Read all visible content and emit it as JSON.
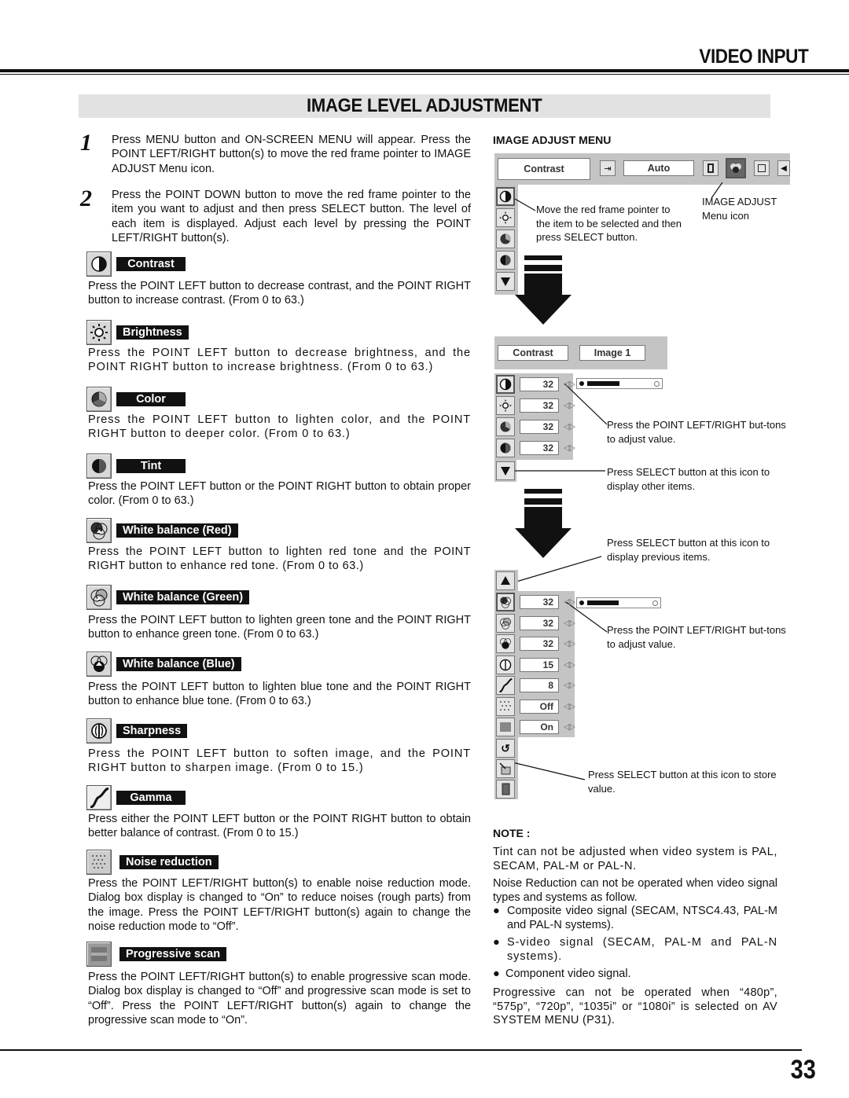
{
  "header": {
    "section": "VIDEO INPUT",
    "title": "IMAGE LEVEL ADJUSTMENT"
  },
  "steps": [
    {
      "number": "1",
      "text": "Press MENU button and ON-SCREEN MENU will appear.  Press the POINT LEFT/RIGHT button(s) to move the red frame pointer to IMAGE ADJUST Menu icon."
    },
    {
      "number": "2",
      "text": "Press the POINT DOWN button to move the red frame pointer to the item you want to adjust and then press SELECT button.  The level of each item is displayed.  Adjust each level by pressing the POINT LEFT/RIGHT button(s)."
    }
  ],
  "items": [
    {
      "icon": "contrast-icon",
      "label": "Contrast",
      "text": "Press the POINT LEFT button to decrease contrast, and the POINT RIGHT button to increase contrast.  (From 0 to 63.)"
    },
    {
      "icon": "brightness-icon",
      "label": "Brightness",
      "text": "Press the POINT LEFT button to decrease brightness, and the POINT RIGHT button to increase brightness.  (From 0 to 63.)"
    },
    {
      "icon": "color-icon",
      "label": "Color",
      "text": "Press the POINT LEFT button to lighten color, and the POINT RIGHT button to deeper color.  (From 0 to 63.)"
    },
    {
      "icon": "tint-icon",
      "label": "Tint",
      "text": "Press the POINT LEFT button or the POINT RIGHT button to obtain proper color.  (From 0 to 63.)"
    },
    {
      "icon": "white-balance-red-icon",
      "label": "White balance (Red)",
      "text": "Press the POINT LEFT button to lighten red tone and the POINT RIGHT button to enhance red tone.  (From 0 to 63.)"
    },
    {
      "icon": "white-balance-green-icon",
      "label": "White balance (Green)",
      "text": "Press the POINT LEFT button to lighten green tone and the POINT RIGHT button to enhance green tone.  (From 0 to 63.)"
    },
    {
      "icon": "white-balance-blue-icon",
      "label": "White balance (Blue)",
      "text": "Press the POINT LEFT button to lighten blue tone and the POINT RIGHT button to enhance blue tone.  (From 0 to 63.)"
    },
    {
      "icon": "sharpness-icon",
      "label": "Sharpness",
      "text": "Press the POINT LEFT button to soften image, and the POINT RIGHT button to sharpen image.  (From 0 to 15.)"
    },
    {
      "icon": "gamma-icon",
      "label": "Gamma",
      "text": "Press either the POINT LEFT button or the POINT RIGHT button to obtain better balance of contrast.  (From 0 to 15.)"
    },
    {
      "icon": "noise-reduction-icon",
      "label": "Noise reduction",
      "text": "Press the POINT LEFT/RIGHT button(s) to enable noise reduction mode.  Dialog box display is changed to “On” to reduce noises (rough parts) from the image. Press the POINT LEFT/RIGHT button(s) again to change the noise reduction mode to “Off”."
    },
    {
      "icon": "progressive-scan-icon",
      "label": "Progressive scan",
      "text": "Press the POINT LEFT/RIGHT button(s) to enable progressive scan mode.  Dialog box display is changed to “Off” and progressive scan mode is set to “Off”. Press the POINT LEFT/RIGHT button(s) again to change the progressive scan mode to “On”."
    }
  ],
  "menu": {
    "heading": "IMAGE ADJUST MENU",
    "top_bar": {
      "item_label": "Contrast",
      "mode_label": "Auto"
    },
    "callout_pointer": "Move the red frame pointer to the item to be selected and then press SELECT button.",
    "callout_menu_icon": "IMAGE ADJUST Menu icon",
    "panel2": {
      "item_label": "Contrast",
      "mode_label": "Image 1",
      "values": [
        "32",
        "32",
        "32",
        "32"
      ],
      "slider_fraction": 0.5
    },
    "callout_adjust": "Press the POINT LEFT/RIGHT but-tons to adjust value.",
    "callout_other": "Press SELECT button at this icon to display other items.",
    "callout_previous": "Press SELECT button at this icon to display previous items.",
    "panel3": {
      "values": [
        "32",
        "32",
        "32",
        "15",
        "8",
        "Off",
        "On"
      ],
      "slider_fraction": 0.5
    },
    "callout_adjust2": "Press the POINT LEFT/RIGHT but-tons to adjust value.",
    "callout_store": "Press SELECT button at this icon to store value."
  },
  "note": {
    "title": "NOTE :",
    "p1": "Tint can not be adjusted when video system is PAL, SECAM, PAL-M or PAL-N.",
    "p2": "Noise Reduction can not be operated when video signal types and systems as follow.",
    "bullets": [
      "Composite video signal (SECAM, NTSC4.43, PAL-M and PAL-N systems).",
      "S-video signal (SECAM, PAL-M and PAL-N systems).",
      "Component video signal."
    ],
    "p3": "Progressive can not be operated when “480p”, “575p”, “720p”, “1035i” or “1080i” is selected on AV SYSTEM MENU (P31)."
  },
  "footer": {
    "page_number": "33"
  }
}
